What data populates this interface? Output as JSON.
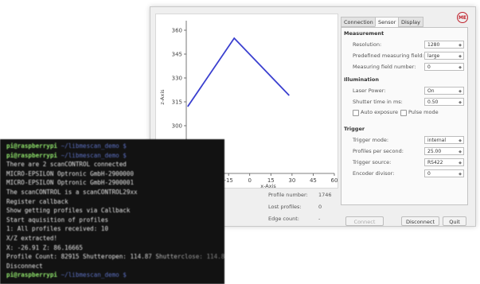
{
  "window": {
    "tabs": [
      {
        "label": "Connection",
        "active": false
      },
      {
        "label": "Sensor",
        "active": true
      },
      {
        "label": "Display",
        "active": false
      }
    ],
    "logo_text": "ME",
    "measurement": {
      "title": "Measurement",
      "resolution_label": "Resolution:",
      "resolution_value": "1280",
      "field_label": "Predefined measuring field:",
      "field_value": "large",
      "field_number_label": "Measuring field number:",
      "field_number_value": "0"
    },
    "illumination": {
      "title": "Illumination",
      "laser_label": "Laser Power:",
      "laser_value": "On",
      "shutter_label": "Shutter time in ms:",
      "shutter_value": "0.50",
      "auto_exposure_label": "Auto exposure",
      "pulse_mode_label": "Pulse mode"
    },
    "trigger": {
      "title": "Trigger",
      "mode_label": "Trigger mode:",
      "mode_value": "internal",
      "pps_label": "Profiles per second:",
      "pps_value": "25.00",
      "source_label": "Trigger source:",
      "source_value": "RS422",
      "divisor_label": "Encoder divisor:",
      "divisor_value": "0"
    },
    "buttons": {
      "connect": "Connect",
      "disconnect": "Disconnect",
      "quit": "Quit"
    },
    "stats": {
      "partial_left": "00",
      "profile_number_label": "Profile number:",
      "profile_number_value": "1746",
      "lost_profiles_label": "Lost profiles:",
      "lost_profiles_value": "0",
      "edge_count_label": "Edge count:",
      "edge_count_value": "-"
    }
  },
  "chart_data": {
    "type": "line",
    "xlabel": "x-Axis",
    "ylabel": "z-Axis",
    "xticks": [
      "-15",
      "0",
      "15",
      "30",
      "45",
      "60"
    ],
    "yticks": [
      "360",
      "345",
      "330",
      "315",
      "300",
      "285"
    ],
    "xlim": [
      -45,
      60
    ],
    "ylim": [
      270,
      366
    ],
    "series": [
      {
        "x": [
          -44,
          -11,
          28
        ],
        "y": [
          312,
          355,
          319
        ],
        "color": "#3a3fcf"
      }
    ]
  },
  "terminal": {
    "lines": [
      {
        "prompt": "pi@raspberrypi",
        "text": " ~/libmescan_demo $"
      },
      {
        "prompt": "pi@raspberrypi",
        "text": " ~/libmescan_demo $"
      },
      {
        "prompt": "",
        "text": "There are 2 scanCONTROL connected"
      },
      {
        "prompt": "",
        "text": "MICRO-EPSILON Optronic GmbH-2900000"
      },
      {
        "prompt": "",
        "text": "MICRO-EPSILON Optronic GmbH-2900001"
      },
      {
        "prompt": "",
        "text": "The scanCONTROL is a scanCONTROL29xx"
      },
      {
        "prompt": "",
        "text": "Register callback"
      },
      {
        "prompt": "",
        "text": "Show getting profiles via Callback"
      },
      {
        "prompt": "",
        "text": "Start aquisition of profiles"
      },
      {
        "prompt": "",
        "text": "1: All profiles received: 10"
      },
      {
        "prompt": "",
        "text": "X/Z extracted!"
      },
      {
        "prompt": "",
        "text": "X: -26.91  Z: 86.16665"
      },
      {
        "prompt": "",
        "text": "Profile Count: 82915 Shutteropen: 114.87 Shutterclose: 114.87"
      },
      {
        "prompt": "",
        "text": "Disconnect"
      },
      {
        "prompt": "pi@raspberrypi",
        "text": " ~/libmescan_demo $"
      }
    ]
  }
}
